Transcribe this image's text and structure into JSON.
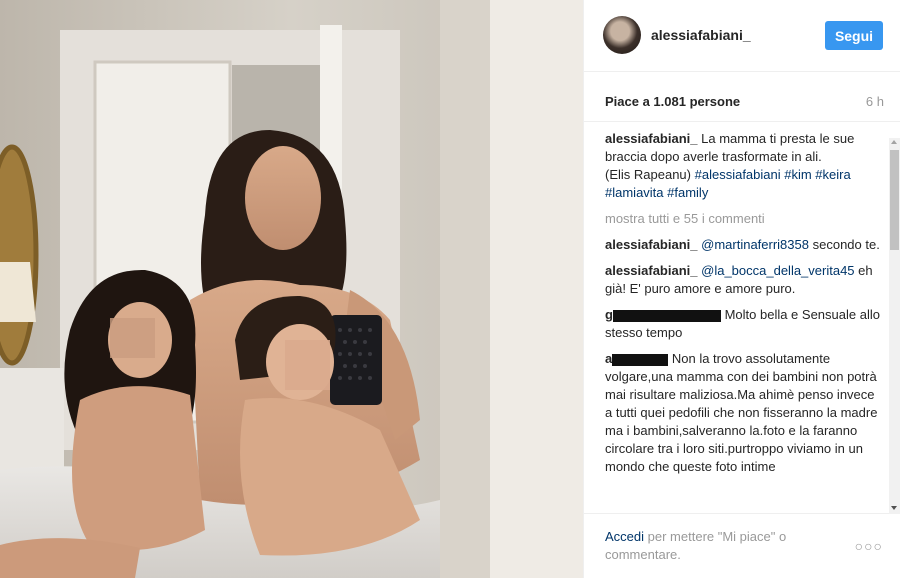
{
  "post": {
    "username": "alessiafabiani_",
    "follow_label": "Segui",
    "likes": "Piace a 1.081 persone",
    "time": "6 h",
    "caption": {
      "user": "alessiafabiani_",
      "text_1": "La mamma ti presta le sue braccia dopo averle trasformate in ali.",
      "text_2": "(Elis Rapeanu)",
      "hashtags": "#alessiafabiani #kim #keira #lamiavita #family"
    },
    "view_all": "mostra tutti e 55 i commenti",
    "comments": [
      {
        "user": "alessiafabiani_",
        "mention": "@martinaferri8358",
        "text": "secondo te."
      },
      {
        "user": "alessiafabiani_",
        "mention": "@la_bocca_della_verita45",
        "text": "eh già! E' puro amore e amore puro."
      },
      {
        "user": "g",
        "text": "Molto bella e Sensuale allo stesso tempo"
      },
      {
        "user": "a",
        "text": "Non la trovo assolutamente volgare,una mamma con dei bambini non potrà mai risultare maliziosa.Ma ahimè penso invece a tutti quei pedofili che non fisseranno la madre ma i bambini,salveranno la.foto e la faranno circolare tra i loro siti.purtroppo viviamo in un mondo che queste foto intime"
      }
    ],
    "footer": {
      "login": "Accedi",
      "rest": "per mettere \"Mi piace\" o commentare.",
      "options": "○○○"
    }
  },
  "colors": {
    "accent": "#3897f0",
    "link": "#003569",
    "muted": "#999999",
    "text": "#262626"
  }
}
